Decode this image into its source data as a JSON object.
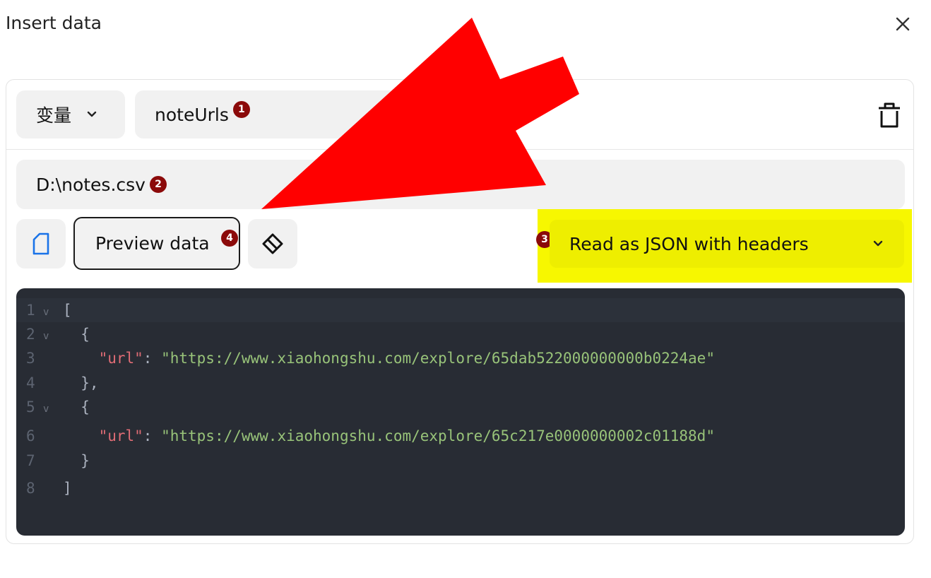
{
  "dialog": {
    "title": "Insert data"
  },
  "variable": {
    "type_label": "变量",
    "name": "noteUrls"
  },
  "file": {
    "path": "D:\\notes.csv"
  },
  "actions": {
    "preview_label": "Preview data"
  },
  "mode": {
    "selected": "Read as JSON with headers"
  },
  "badges": {
    "b1": "1",
    "b2": "2",
    "b3": "3",
    "b4": "4"
  },
  "editor": {
    "lines": [
      {
        "num": "1",
        "fold": "v",
        "code": "["
      },
      {
        "num": "2",
        "fold": "v",
        "code": "  {"
      },
      {
        "num": "3",
        "fold": "",
        "indent": "    ",
        "key": "\"url\"",
        "sep": ": ",
        "value": "\"https://www.xiaohongshu.com/explore/65dab522000000000b0224ae\""
      },
      {
        "num": "4",
        "fold": "",
        "code": "  },"
      },
      {
        "num": "5",
        "fold": "v",
        "code": "  {"
      },
      {
        "num": "6",
        "fold": "",
        "indent": "    ",
        "key": "\"url\"",
        "sep": ": ",
        "value": "\"https://www.xiaohongshu.com/explore/65c217e0000000002c01188d\""
      },
      {
        "num": "7",
        "fold": "",
        "code": "  }"
      },
      {
        "num": "8",
        "fold": "",
        "code": "]"
      }
    ]
  },
  "colors": {
    "highlight": "#f7f700",
    "annotation_arrow": "#ff0000",
    "badge": "#8b0a0a",
    "editor_bg": "#282c34"
  },
  "icons": {
    "close": "close-icon",
    "chevron": "chevron-down-icon",
    "trash": "trash-icon",
    "file": "file-icon",
    "eraser": "eraser-icon"
  }
}
